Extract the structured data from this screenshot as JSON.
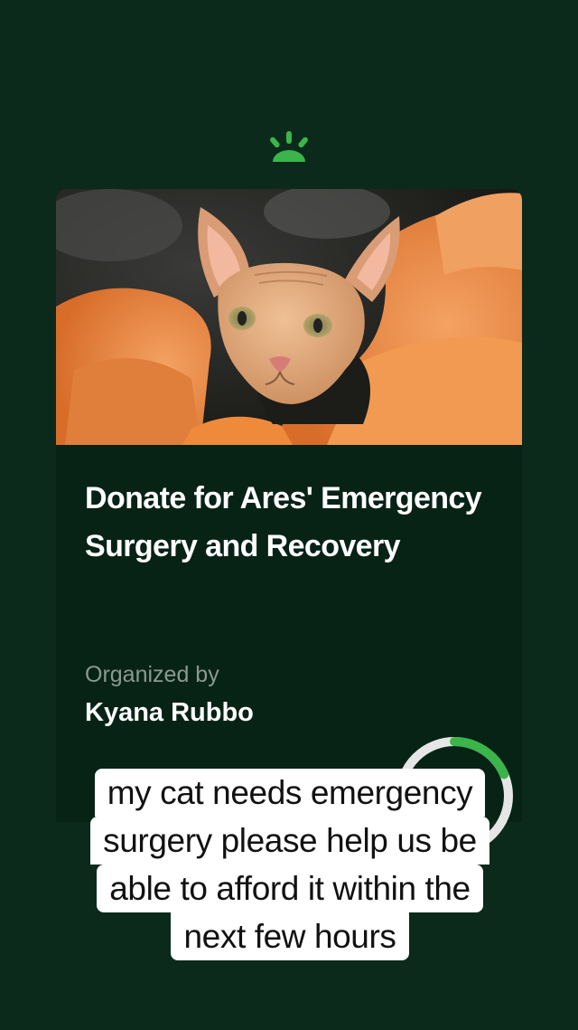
{
  "brand": {
    "logo_icon": "gofundme-sprout-logo",
    "accent_color": "#3ab54a"
  },
  "fundraiser": {
    "photo_icon": "hairless-sphynx-cat-photo",
    "title": "Donate for Ares' Emergency Surgery and Recovery",
    "organized_label": "Organized by",
    "organizer_name": "Kyana Rubbo"
  },
  "caption": {
    "lines": [
      "my cat needs emergency",
      "surgery please help us be",
      "able to afford it within the",
      "next few hours"
    ]
  },
  "colors": {
    "background": "#0b2a1c",
    "card": "#072316",
    "progress_track": "#e6e6e6",
    "progress_fill": "#3ab54a"
  }
}
